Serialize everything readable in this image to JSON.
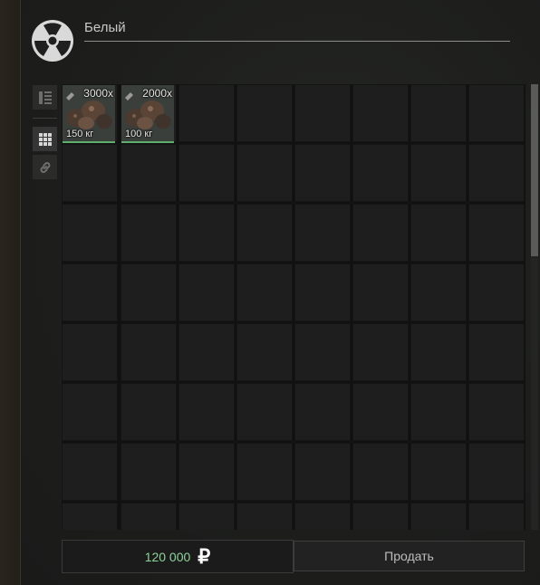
{
  "header": {
    "faction_icon": "radiation-icon",
    "name": "Белый"
  },
  "toolbar": {
    "items": [
      {
        "icon": "list-grid-icon"
      },
      {
        "icon": "grid-icon"
      },
      {
        "icon": "link-icon"
      }
    ]
  },
  "inventory": {
    "items": [
      {
        "quantity": "3000x",
        "weight": "150 кг",
        "icon": "ore-chunks-icon"
      },
      {
        "quantity": "2000x",
        "weight": "100 кг",
        "icon": "ore-chunks-icon"
      }
    ]
  },
  "footer": {
    "price": "120 000",
    "currency_icon": "ruble-icon",
    "currency_symbol": "₽",
    "sell_label": "Продать"
  },
  "colors": {
    "price": "#8ed49a",
    "item_border": "#5fae6d"
  }
}
